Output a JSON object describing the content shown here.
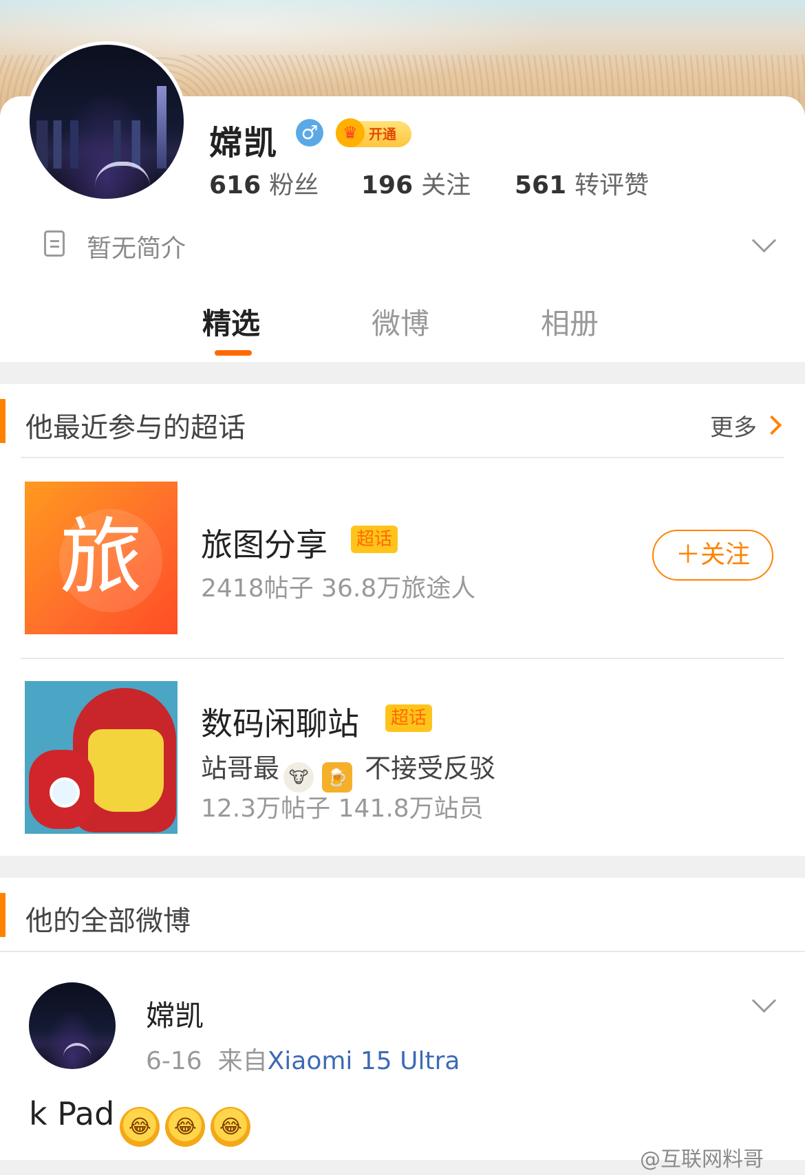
{
  "profile": {
    "name": "嫦凯",
    "gender_symbol": "♂",
    "vip_label": "开通",
    "stats": [
      {
        "num": "616",
        "label": "粉丝"
      },
      {
        "num": "196",
        "label": "关注"
      },
      {
        "num": "561",
        "label": "转评赞"
      }
    ],
    "bio": "暂无简介"
  },
  "tabs": [
    {
      "label": "精选",
      "active": true
    },
    {
      "label": "微博",
      "active": false
    },
    {
      "label": "相册",
      "active": false
    }
  ],
  "super_topics_section": {
    "title": "他最近参与的超话",
    "more_label": "更多",
    "accent_color": "#ff8200",
    "topics": [
      {
        "name": "旅图分享",
        "tag": "超话",
        "thumb_glyph": "旅",
        "stats": "2418帖子 36.8万旅途人",
        "follow_label": "＋关注"
      },
      {
        "name": "数码闲聊站",
        "tag": "超话",
        "desc_prefix": "站哥最",
        "desc_emoji_1": "🐮",
        "desc_emoji_2": "🍺",
        "desc_suffix": "不接受反驳",
        "stats": "12.3万帖子 141.8万站员"
      }
    ]
  },
  "weibo_section": {
    "title": "他的全部微博",
    "post": {
      "author": "嫦凯",
      "date": "6-16",
      "source_prefix": "来自",
      "device": "Xiaomi 15 Ultra",
      "text": "k Pad",
      "emoji": "😂"
    }
  },
  "watermark": "@互联网料哥"
}
